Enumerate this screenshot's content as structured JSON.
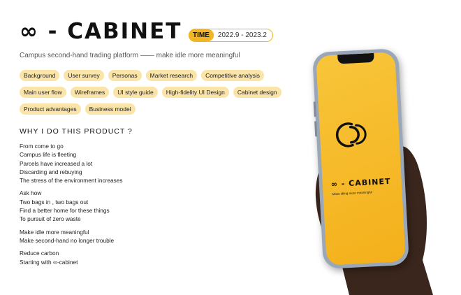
{
  "header": {
    "logo_text": "∞ - CABINET",
    "time_label": "TIME",
    "time_range": "2022.9 - 2023.2",
    "subtitle": "Campus second-hand trading platform —— make idle more meaningful"
  },
  "tags": [
    "Background",
    "User survey",
    "Personas",
    "Market research",
    "Competitive analysis",
    "Main user flow",
    "Wireframes",
    "UI style guide",
    "High-fidelity UI Design",
    "Cabinet design",
    "Product advantages",
    "Business model"
  ],
  "why": {
    "heading": "WHY I DO THIS PRODUCT ?",
    "paragraphs": [
      [
        "From come to go",
        "Campus life is fleeting",
        "Parcels have increased a lot",
        "Discarding and rebuying",
        "The stress of the environment increases"
      ],
      [
        "Ask how",
        "Two bags in , two bags out",
        "Find a better home for these things",
        "To pursuit of zero waste"
      ],
      [
        "Make idle more meaningful",
        "Make second-hand no longer trouble"
      ],
      [
        "Reduce carbon",
        "Starting with ∞-cabinet"
      ]
    ]
  },
  "phone": {
    "app_title": "∞ - CABINET",
    "app_slogan": "Make idling more meaningful"
  },
  "colors": {
    "accent": "#f2b625",
    "tag_bg": "#fbe4a8",
    "screen": "#f4b01b"
  }
}
